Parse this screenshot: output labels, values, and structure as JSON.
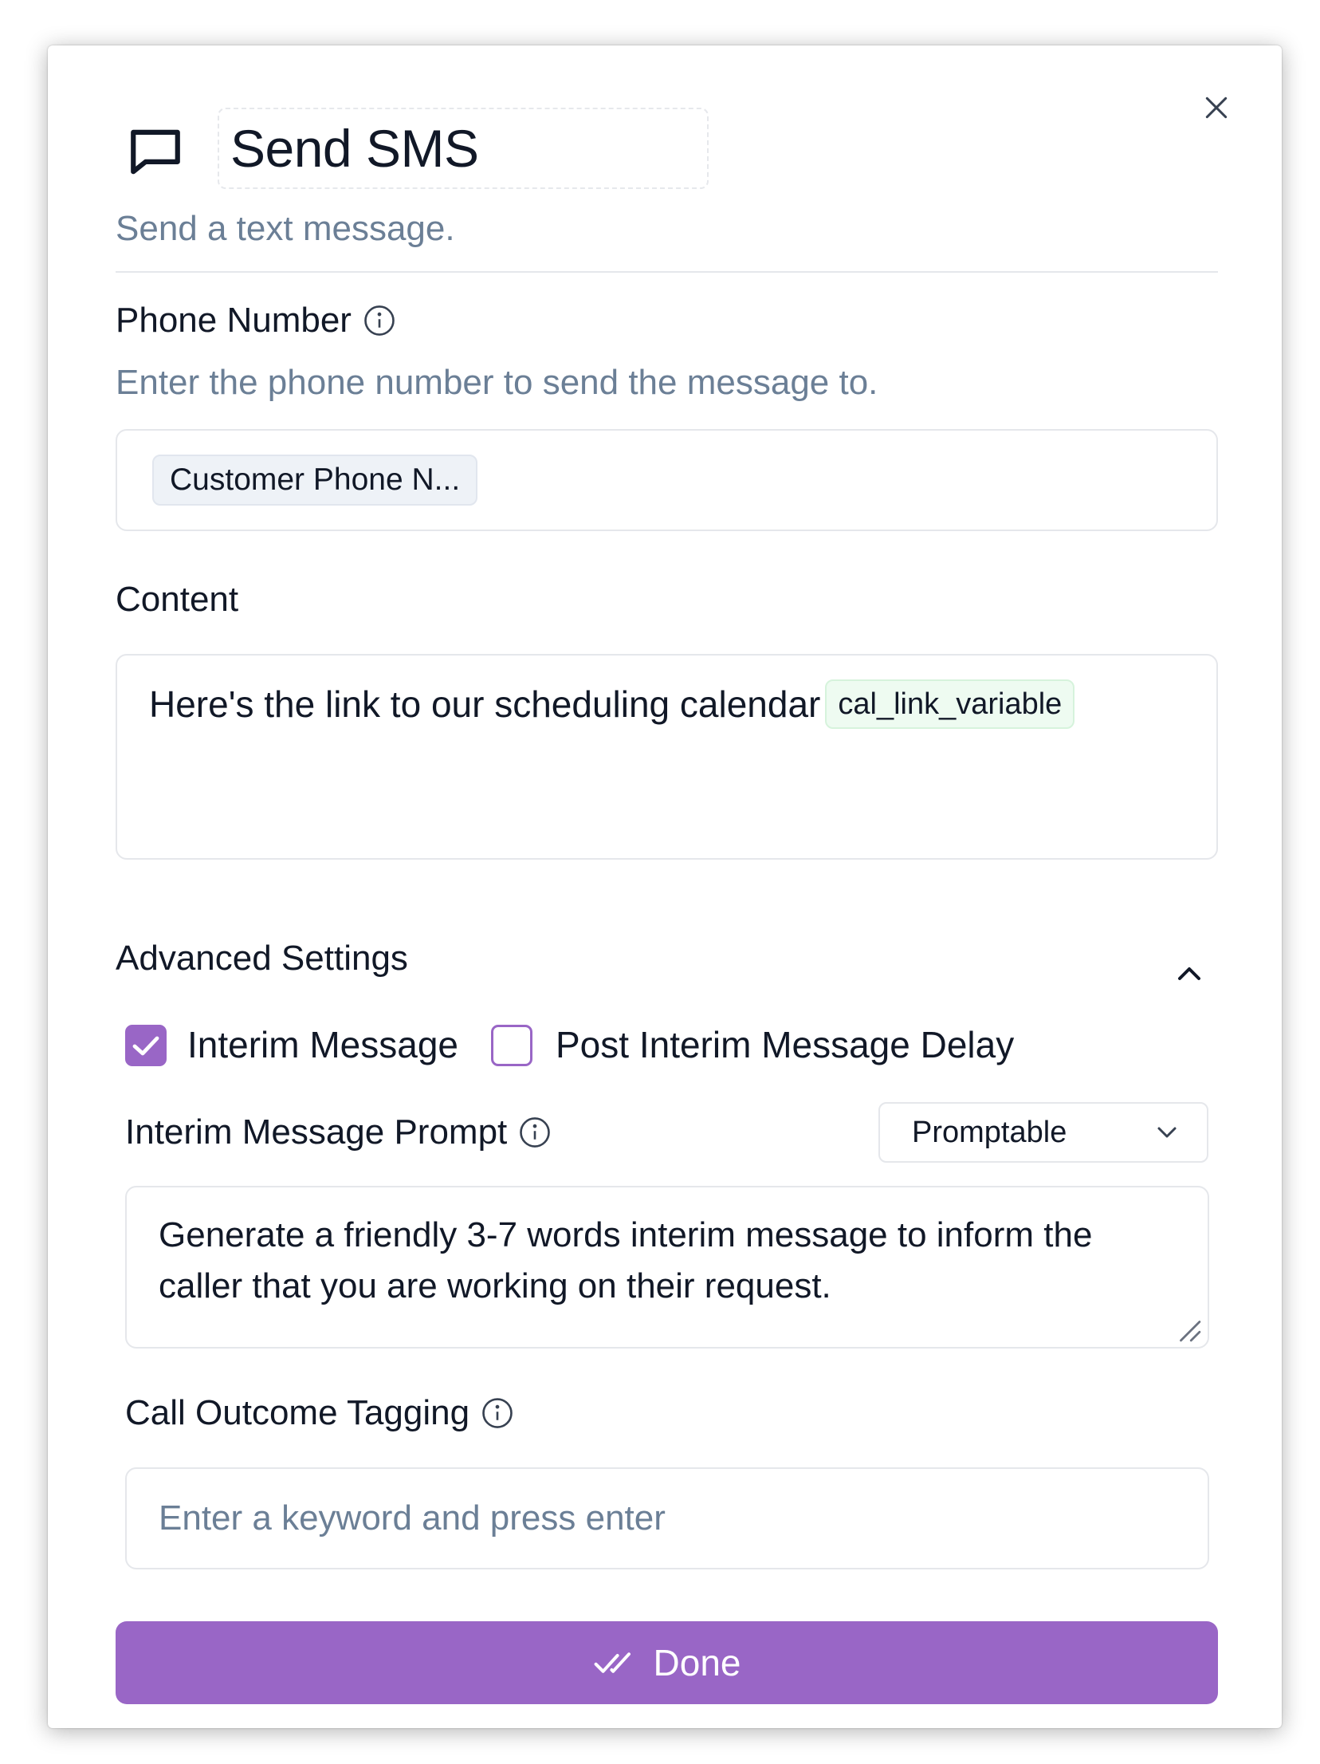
{
  "header": {
    "title": "Send SMS",
    "subtitle": "Send a text message.",
    "icon": "message-square-icon"
  },
  "phone_number": {
    "label": "Phone Number",
    "description": "Enter the phone number to send the message to.",
    "chip": "Customer Phone N..."
  },
  "content": {
    "label": "Content",
    "text": "Here's the link to our scheduling calendar",
    "variable_chip": "cal_link_variable"
  },
  "advanced": {
    "label": "Advanced Settings",
    "expanded": true,
    "interim_message": {
      "label": "Interim Message",
      "checked": true
    },
    "post_interim_delay": {
      "label": "Post Interim Message Delay",
      "checked": false
    },
    "prompt": {
      "label": "Interim Message Prompt",
      "mode": "Promptable",
      "text": "Generate a friendly 3-7 words interim message to inform the caller that you are working on their request."
    },
    "tagging": {
      "label": "Call Outcome Tagging",
      "placeholder": "Enter a keyword and press enter"
    }
  },
  "done": {
    "label": "Done"
  },
  "colors": {
    "accent": "#9966c6",
    "muted_text": "#6b7f96",
    "border": "#e5e7eb",
    "variable_chip_bg": "#eefbf1"
  }
}
